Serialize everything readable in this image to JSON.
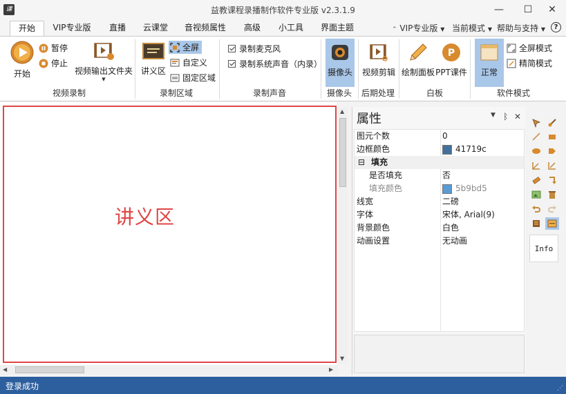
{
  "window": {
    "icon_text": "课",
    "title": "益教课程录播制作软件专业版 v2.3.1.9",
    "minimize": "—",
    "maximize": "☐",
    "close": "✕"
  },
  "tabs": [
    {
      "label": "开始"
    },
    {
      "label": "VIP专业版"
    },
    {
      "label": "直播"
    },
    {
      "label": "云课堂"
    },
    {
      "label": "音视频属性"
    },
    {
      "label": "高级"
    },
    {
      "label": "小工具"
    },
    {
      "label": "界面主题"
    }
  ],
  "right_menu": {
    "vip": "VIP专业版",
    "mode": "当前模式",
    "help": "帮助与支持",
    "help_icon": "?"
  },
  "ribbon": {
    "video_record": {
      "start": "开始",
      "pause": "暂停",
      "stop": "停止",
      "output_folder": "视频输出文件夹",
      "group": "视频录制"
    },
    "record_area": {
      "handout": "讲义区",
      "fullscreen": "全屏",
      "custom": "自定义",
      "fixed_area": "固定区域",
      "group": "录制区域"
    },
    "record_sound": {
      "mic": "录制麦克风",
      "system_sound": "录制系统声音（内录）",
      "group": "录制声音"
    },
    "camera": {
      "camera": "摄像头",
      "group": "摄像头"
    },
    "post": {
      "video_edit": "视频剪辑",
      "group": "后期处理"
    },
    "whiteboard": {
      "draw_panel": "绘制面板",
      "ppt": "PPT课件",
      "group": "白板"
    },
    "software_mode": {
      "normal": "正常",
      "fullscreen_mode": "全屏模式",
      "compact_mode": "精简模式",
      "group": "软件模式"
    }
  },
  "canvas": {
    "label": "讲义区",
    "border_color": "#e04545"
  },
  "properties": {
    "title": "属性",
    "rows": [
      {
        "key": "图元个数",
        "value": "0"
      },
      {
        "key": "边框颜色",
        "value": "41719c",
        "color": "#41719c"
      },
      {
        "key": "填充",
        "value": ""
      },
      {
        "key": "是否填充",
        "value": "否"
      },
      {
        "key": "填充颜色",
        "value": "5b9bd5",
        "color": "#5b9bd5"
      },
      {
        "key": "线宽",
        "value": "二磅"
      },
      {
        "key": "字体",
        "value": "宋体, Arial(9)"
      },
      {
        "key": "背景颜色",
        "value": "白色"
      },
      {
        "key": "动画设置",
        "value": "无动画"
      }
    ]
  },
  "toolbar": {
    "info_label": "Info"
  },
  "status": {
    "text": "登录成功"
  },
  "colors": {
    "accent_blue": "#2d5f9e",
    "selected_bg": "#a9c7e8",
    "border_color_swatch": "#41719c",
    "fill_color_swatch": "#5b9bd5"
  }
}
